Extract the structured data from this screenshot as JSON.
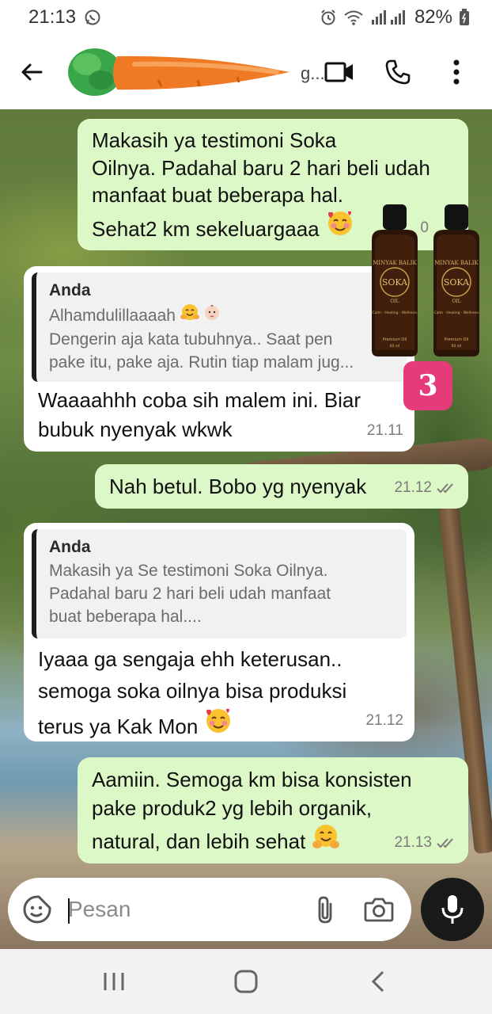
{
  "status_bar": {
    "time": "21:13",
    "battery": "82%",
    "icons": [
      "whatsapp-icon",
      "alarm-icon",
      "wifi-icon",
      "signal-icon",
      "battery-icon"
    ]
  },
  "header": {
    "contact_name": "g...",
    "avatar": "carrot-icon",
    "actions": [
      "video-call-icon",
      "phone-icon",
      "more-icon"
    ]
  },
  "messages": [
    {
      "type": "out",
      "lines": [
        "Makasih ya      testimoni Soka",
        "Oilnya. Padahal baru 2 hari beli udah",
        "manfaat buat beberapa hal.",
        "Sehat2 km sekeluargaaa"
      ],
      "time": "0"
    },
    {
      "type": "in",
      "quote_author": "Anda",
      "quote_lines": [
        "Alhamdulillaaaah",
        "Dengerin aja kata tubuhnya.. Saat pen",
        "pake itu, pake aja. Rutin tiap malam jug..."
      ],
      "lines": [
        "Waaaahhh coba sih malem ini. Biar",
        "bubuk nyenyak wkwk"
      ],
      "time": "21.11"
    },
    {
      "type": "out",
      "lines": [
        "Nah betul. Bobo yg nyenyak"
      ],
      "time": "21.12"
    },
    {
      "type": "in",
      "quote_author": "Anda",
      "quote_lines": [
        "Makasih ya Se testimoni Soka Oilnya.",
        "Padahal baru 2 hari beli udah manfaat",
        "buat beberapa hal...."
      ],
      "lines": [
        "Iyaaa ga sengaja ehh keterusan..",
        "semoga soka oilnya bisa produksi",
        "terus ya Kak Mon"
      ],
      "time": "21.12"
    },
    {
      "type": "out",
      "lines": [
        "Aamiin. Semoga km bisa konsisten",
        "pake produk2 yg lebih organik,",
        "natural, dan lebih sehat"
      ],
      "time": "21.13"
    }
  ],
  "product_overlay": {
    "bottle_label_top": "MINYAK BALIK",
    "bottle_brand": "SOKA",
    "bottle_sub": "OIL",
    "bottle_tagline": "Calm · Healing · Wellness",
    "bottle_footer": "Premium Oil",
    "bottle_volume": "60 ml",
    "badge": "3"
  },
  "input": {
    "placeholder": "Pesan"
  },
  "colors": {
    "outgoing_bubble": "#dcf8c6",
    "incoming_bubble": "#ffffff",
    "badge": "#e63b7a",
    "mic_button": "#1a1a1a"
  }
}
